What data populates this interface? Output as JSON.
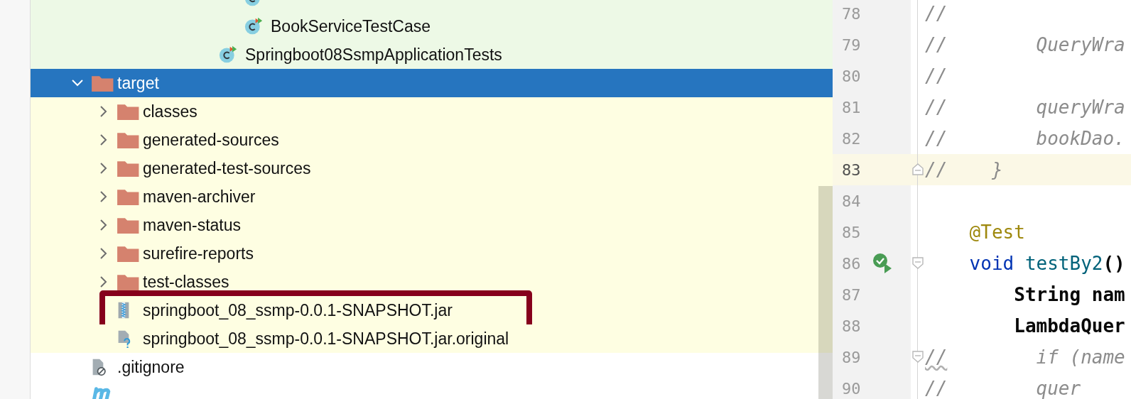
{
  "test_tree_tail": [
    {
      "kind": "package-tail",
      "children": [
        {
          "kind": "test-class",
          "selected": false
        },
        {
          "kind": "test-class",
          "label": "BookServiceTestCase",
          "selected": false
        }
      ]
    },
    {
      "kind": "test-class",
      "label": "Springboot08SsmpApplicationTests",
      "selected": false
    }
  ],
  "tree": [
    {
      "kind": "folder",
      "label": "target",
      "expanded": true,
      "selected": true,
      "excluded": true,
      "highlighted": false,
      "children": [
        {
          "kind": "folder",
          "label": "classes",
          "expanded": false,
          "selected": false,
          "highlighted": false
        },
        {
          "kind": "folder",
          "label": "generated-sources",
          "expanded": false,
          "selected": false,
          "highlighted": false
        },
        {
          "kind": "folder",
          "label": "generated-test-sources",
          "expanded": false,
          "selected": false,
          "highlighted": false
        },
        {
          "kind": "folder",
          "label": "maven-archiver",
          "expanded": false,
          "selected": false,
          "highlighted": false
        },
        {
          "kind": "folder",
          "label": "maven-status",
          "expanded": false,
          "selected": false,
          "highlighted": false
        },
        {
          "kind": "folder",
          "label": "surefire-reports",
          "expanded": false,
          "selected": false,
          "highlighted": false
        },
        {
          "kind": "folder",
          "label": "test-classes",
          "expanded": false,
          "selected": false,
          "highlighted": false
        },
        {
          "kind": "jar",
          "label": "springboot_08_ssmp-0.0.1-SNAPSHOT.jar",
          "selected": false,
          "highlighted": true
        },
        {
          "kind": "unknown-file",
          "label": "springboot_08_ssmp-0.0.1-SNAPSHOT.jar.original",
          "selected": false,
          "highlighted": false
        }
      ]
    },
    {
      "kind": "ignore-file",
      "label": ".gitignore",
      "selected": false,
      "excluded": false,
      "highlighted": false
    },
    {
      "kind": "maven-file",
      "selected": false,
      "excluded": false,
      "highlighted": false
    }
  ],
  "editor": {
    "lines": [
      {
        "number": "78",
        "current": false,
        "test_passed": false,
        "fold_start": false,
        "fold_end": false,
        "warning": false,
        "segments": [
          {
            "kind": "comment",
            "text": "//"
          }
        ]
      },
      {
        "number": "79",
        "current": false,
        "test_passed": false,
        "fold_start": false,
        "fold_end": false,
        "warning": false,
        "segments": [
          {
            "kind": "comment",
            "text": "//        QueryWra"
          }
        ]
      },
      {
        "number": "80",
        "current": false,
        "test_passed": false,
        "fold_start": false,
        "fold_end": false,
        "warning": false,
        "segments": [
          {
            "kind": "comment",
            "text": "//"
          }
        ]
      },
      {
        "number": "81",
        "current": false,
        "test_passed": false,
        "fold_start": false,
        "fold_end": false,
        "warning": false,
        "segments": [
          {
            "kind": "comment",
            "text": "//        queryWra"
          }
        ]
      },
      {
        "number": "82",
        "current": false,
        "test_passed": false,
        "fold_start": false,
        "fold_end": false,
        "warning": false,
        "segments": [
          {
            "kind": "comment",
            "text": "//        bookDao."
          }
        ]
      },
      {
        "number": "83",
        "current": true,
        "test_passed": false,
        "fold_start": false,
        "fold_end": true,
        "warning": false,
        "segments": [
          {
            "kind": "comment",
            "text": "//    }"
          }
        ]
      },
      {
        "number": "84",
        "current": false,
        "test_passed": false,
        "fold_start": false,
        "fold_end": false
      },
      {
        "number": "85",
        "current": false,
        "test_passed": false,
        "fold_start": false,
        "fold_end": false,
        "warning": false,
        "segments": [
          {
            "kind": "annotation",
            "text": "    @Test"
          }
        ]
      },
      {
        "number": "86",
        "current": false,
        "test_passed": true,
        "fold_start": true,
        "fold_end": false,
        "warning": false,
        "segments": [
          {
            "kind": "keyword",
            "text": "    void"
          },
          {
            "kind": "method",
            "text": " testBy2"
          },
          {
            "kind": "plain",
            "text": "()"
          }
        ]
      },
      {
        "number": "87",
        "current": false,
        "test_passed": false,
        "fold_start": false,
        "fold_end": false,
        "warning": false,
        "segments": [
          {
            "kind": "plain",
            "text": "        String nam"
          }
        ]
      },
      {
        "number": "88",
        "current": false,
        "test_passed": false,
        "fold_start": false,
        "fold_end": false,
        "warning": false,
        "segments": [
          {
            "kind": "plain",
            "text": "        LambdaQuer"
          }
        ]
      },
      {
        "number": "89",
        "current": false,
        "test_passed": false,
        "fold_start": true,
        "fold_end": false,
        "warning": true,
        "segments": [
          {
            "kind": "comment",
            "text": "//"
          },
          {
            "kind": "comment",
            "text": "        if (name"
          }
        ]
      },
      {
        "number": "90",
        "current": false,
        "test_passed": false,
        "fold_start": false,
        "fold_end": false,
        "warning": false,
        "segments": [
          {
            "kind": "comment",
            "text": "//        quer"
          }
        ]
      }
    ]
  }
}
